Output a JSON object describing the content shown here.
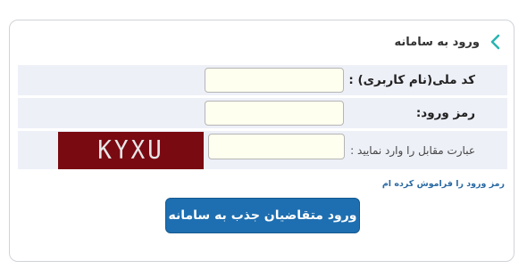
{
  "header": {
    "title": "ورود به سامانه",
    "icon": "chevron-left-icon",
    "icon_color": "#2bb5b0"
  },
  "form": {
    "national_id_label": "کد ملی(نام کاربری) :",
    "national_id_value": "",
    "password_label": "رمز ورود:",
    "password_value": "",
    "captcha_label": "عبارت مقابل را وارد نمایید :",
    "captcha_value": "",
    "captcha_text": "KYXU"
  },
  "forgot_link": "رمز ورود را فراموش کرده ام",
  "login_button": "ورود متقاضیان جذب به سامانه",
  "colors": {
    "row_background": "#eef0f8",
    "input_background": "#fffff0",
    "button_background": "#1e6fb1",
    "captcha_background": "#7a0a12",
    "link": "#2b6aa3"
  }
}
